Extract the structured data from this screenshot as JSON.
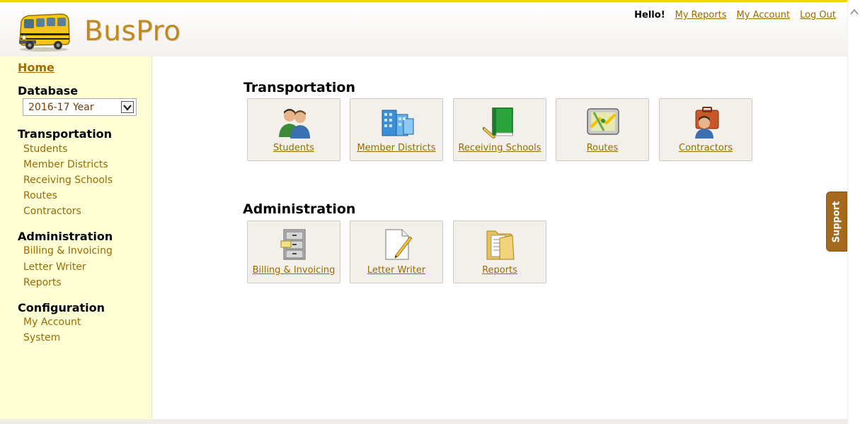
{
  "header": {
    "brand": "BusPro",
    "hello": "Hello!",
    "links": [
      "My Reports",
      "My Account",
      "Log Out"
    ]
  },
  "sidebar": {
    "home": "Home",
    "database_heading": "Database",
    "database_value": "2016-17 Year",
    "sections": [
      {
        "heading": "Transportation",
        "items": [
          "Students",
          "Member Districts",
          "Receiving Schools",
          "Routes",
          "Contractors"
        ]
      },
      {
        "heading": "Administration",
        "items": [
          "Billing & Invoicing",
          "Letter Writer",
          "Reports"
        ]
      },
      {
        "heading": "Configuration",
        "items": [
          "My Account",
          "System"
        ]
      }
    ]
  },
  "main": {
    "transportation_title": "Transportation",
    "transportation_tiles": [
      {
        "label": "Students",
        "icon": "users-icon"
      },
      {
        "label": "Member Districts",
        "icon": "buildings-icon"
      },
      {
        "label": "Receiving Schools",
        "icon": "book-icon"
      },
      {
        "label": "Routes",
        "icon": "map-device-icon"
      },
      {
        "label": "Contractors",
        "icon": "contractor-icon"
      }
    ],
    "administration_title": "Administration",
    "administration_tiles": [
      {
        "label": "Billing & Invoicing",
        "icon": "file-cabinet-icon"
      },
      {
        "label": "Letter Writer",
        "icon": "document-pencil-icon"
      },
      {
        "label": "Reports",
        "icon": "folder-icon"
      }
    ]
  },
  "support": {
    "label": "Support"
  },
  "colors": {
    "accent": "#c08a1f",
    "link": "#9a6a00",
    "sidebar_bg": "#ffffd6",
    "topbar": "#f2d300",
    "support_bg": "#a56a1b"
  }
}
